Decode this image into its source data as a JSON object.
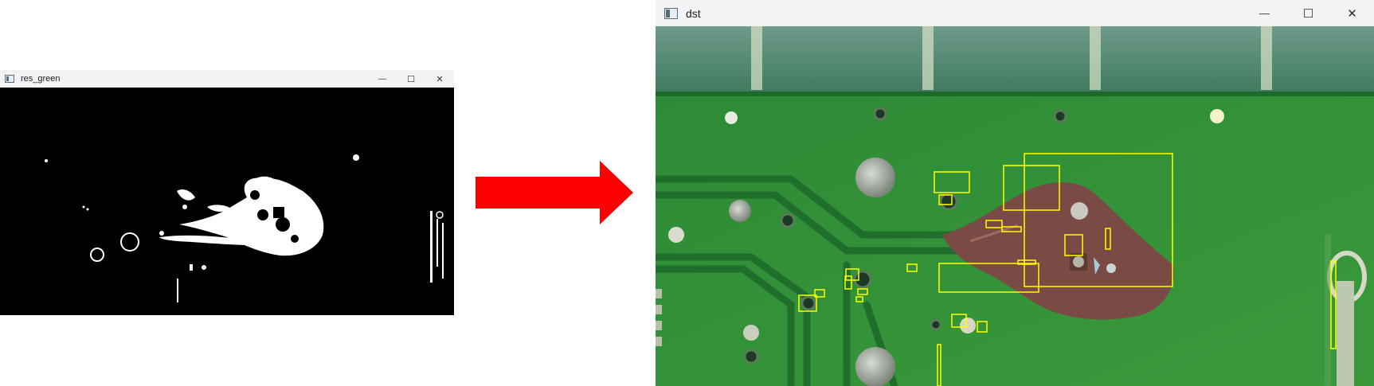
{
  "left_window": {
    "title": "res_green",
    "controls": {
      "minimize": "—",
      "maximize": "☐",
      "close": "✕"
    }
  },
  "right_window": {
    "title": "dst",
    "controls": {
      "minimize": "—",
      "maximize": "☐",
      "close": "✕"
    }
  },
  "arrow": {
    "color": "#ff0000"
  },
  "colors": {
    "mask_background": "#000000",
    "mask_foreground": "#ffffff",
    "pcb_green": "#2f8a35",
    "trace_green": "#1e6b2c",
    "rust": "#7a4a45",
    "bounding_box": "#ffff00",
    "titlebar": "#f3f3f3"
  }
}
